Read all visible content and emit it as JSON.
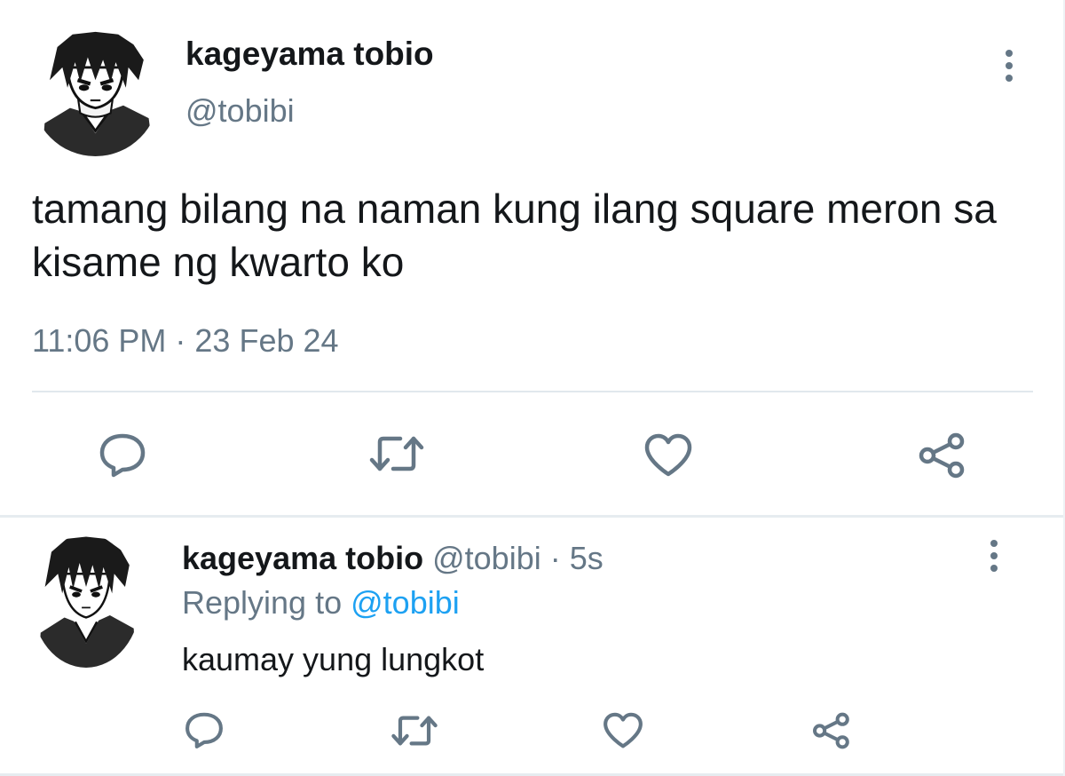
{
  "main_tweet": {
    "author_name": "kageyama tobio",
    "author_handle": "@tobibi",
    "text": "tamang bilang na naman kung ilang square meron sa kisame ng kwarto ko",
    "timestamp": "11:06 PM · 23 Feb 24",
    "actions": [
      "reply-icon",
      "retweet-icon",
      "like-icon",
      "share-icon"
    ]
  },
  "reply_tweet": {
    "author_name": "kageyama tobio",
    "author_handle": "@tobibi",
    "separator": "·",
    "time": "5s",
    "replying_prefix": "Replying to",
    "replying_handle": "@tobibi",
    "text": "kaumay yung lungkot",
    "actions": [
      "reply-icon",
      "retweet-icon",
      "like-icon",
      "share-icon"
    ]
  },
  "colors": {
    "text": "#14171a",
    "secondary": "#657786",
    "link": "#1da1f2",
    "divider": "#e1e8ed"
  }
}
